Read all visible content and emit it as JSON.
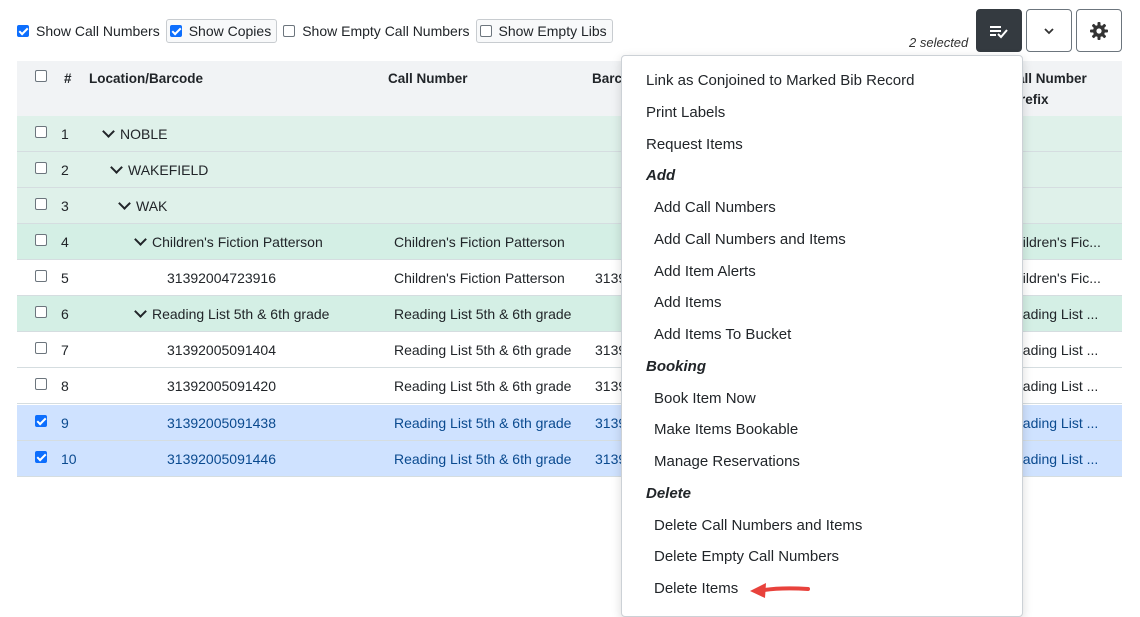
{
  "filters": [
    {
      "label": "Show Call Numbers",
      "checked": true
    },
    {
      "label": "Show Copies",
      "checked": true
    },
    {
      "label": "Show Empty Call Numbers",
      "checked": false
    },
    {
      "label": "Show Empty Libs",
      "checked": false
    }
  ],
  "toolbar": {
    "selected_text": "2 selected",
    "actions_icon": "list-check-icon",
    "dropdown_icon": "chevron-down-icon",
    "settings_icon": "gear-icon"
  },
  "grid": {
    "columns": [
      "#",
      "Location/Barcode",
      "Call Number",
      "Barco",
      "all Number",
      "refix"
    ],
    "rows": [
      {
        "num": "1",
        "label": "NOBLE",
        "call": "",
        "barcode": "",
        "prefix": "",
        "checked": false
      },
      {
        "num": "2",
        "label": "WAKEFIELD",
        "call": "",
        "barcode": "",
        "prefix": "",
        "checked": false
      },
      {
        "num": "3",
        "label": "WAK",
        "call": "",
        "barcode": "",
        "prefix": "",
        "checked": false
      },
      {
        "num": "4",
        "label": "Children's Fiction Patterson",
        "call": "Children's Fiction Patterson",
        "barcode": "",
        "prefix": "hildren's Fic...",
        "checked": false
      },
      {
        "num": "5",
        "label": "31392004723916",
        "call": "Children's Fiction Patterson",
        "barcode": "3139",
        "prefix": "hildren's Fic...",
        "checked": false
      },
      {
        "num": "6",
        "label": "Reading List 5th & 6th grade",
        "call": "Reading List 5th & 6th grade",
        "barcode": "",
        "prefix": "eading List ...",
        "checked": false
      },
      {
        "num": "7",
        "label": "31392005091404",
        "call": "Reading List 5th & 6th grade",
        "barcode": "3139",
        "prefix": "eading List ...",
        "checked": false
      },
      {
        "num": "8",
        "label": "31392005091420",
        "call": "Reading List 5th & 6th grade",
        "barcode": "3139",
        "prefix": "eading List ...",
        "checked": false
      },
      {
        "num": "9",
        "label": "31392005091438",
        "call": "Reading List 5th & 6th grade",
        "barcode": "3139",
        "prefix": "eading List ...",
        "checked": true
      },
      {
        "num": "10",
        "label": "31392005091446",
        "call": "Reading List 5th & 6th grade",
        "barcode": "3139",
        "prefix": "eading List ...",
        "checked": true
      }
    ]
  },
  "menu": {
    "top_items": [
      "Link as Conjoined to Marked Bib Record",
      "Print Labels",
      "Request Items"
    ],
    "sections": [
      {
        "header": "Add",
        "items": [
          "Add Call Numbers",
          "Add Call Numbers and Items",
          "Add Item Alerts",
          "Add Items",
          "Add Items To Bucket"
        ]
      },
      {
        "header": "Booking",
        "items": [
          "Book Item Now",
          "Make Items Bookable",
          "Manage Reservations"
        ]
      },
      {
        "header": "Delete",
        "items": [
          "Delete Call Numbers and Items",
          "Delete Empty Call Numbers",
          "Delete Items"
        ]
      }
    ],
    "arrow_color": "#e8423c"
  }
}
